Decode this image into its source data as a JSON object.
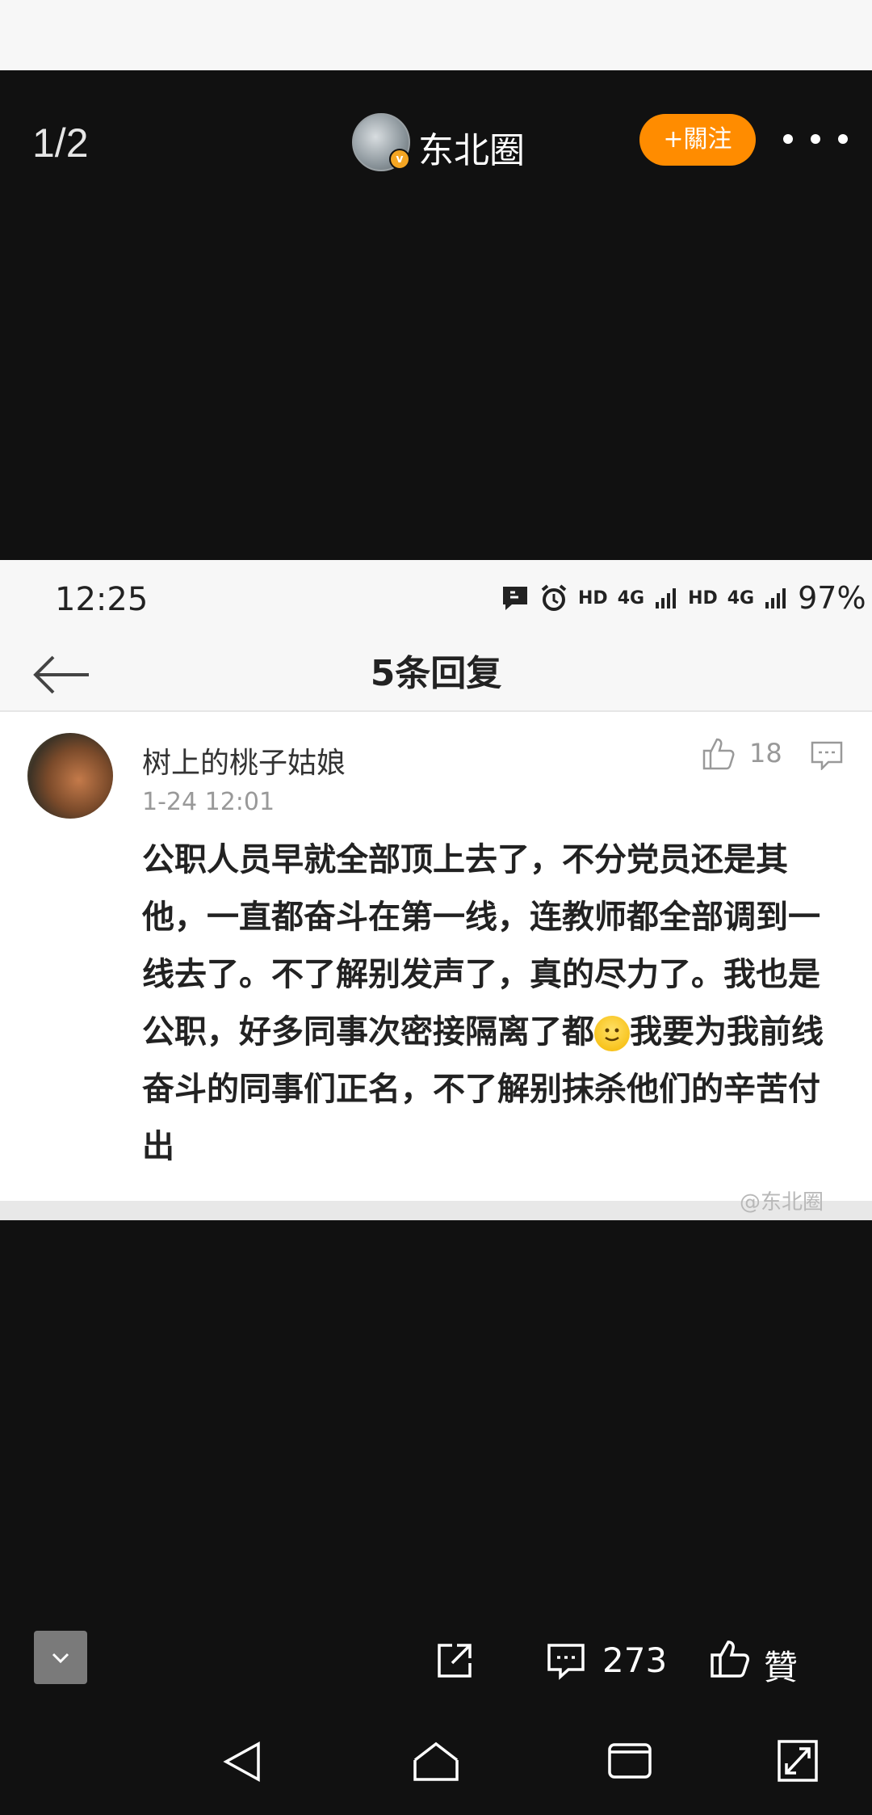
{
  "viewer": {
    "page_indicator": "1/2",
    "author_name": "东北圈",
    "follow_label": "+關注"
  },
  "screenshot": {
    "status_bar": {
      "time": "12:25",
      "hd1": "HD",
      "net1": "4G",
      "hd2": "HD",
      "net2": "4G",
      "battery": "97%"
    },
    "nav": {
      "title": "5条回复"
    },
    "comment": {
      "user": "树上的桃子姑娘",
      "time": "1-24 12:01",
      "likes": "18",
      "text_before_emoji": "公职人员早就全部顶上去了，不分党员还是其他，一直都奋斗在第一线，连教师都全部调到一线去了。不了解别发声了，真的尽力了。我也是公职，好多同事次密接隔离了都",
      "text_after_emoji": "我要为我前线奋斗的同事们正名，不了解别抹杀他们的辛苦付出"
    },
    "watermark": "@东北圈"
  },
  "bottom_bar": {
    "comment_count": "273",
    "like_label": "贊"
  }
}
